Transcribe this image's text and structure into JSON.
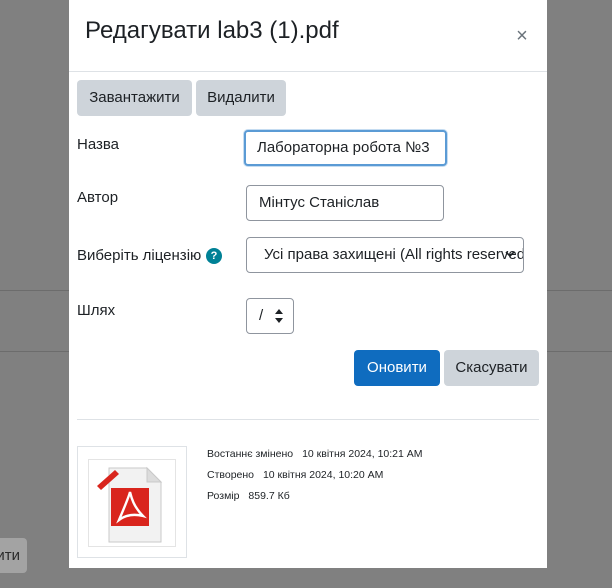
{
  "dialog": {
    "title": "Редагувати lab3 (1).pdf",
    "close_glyph": "×"
  },
  "toolbar": {
    "download_label": "Завантажити",
    "delete_label": "Видалити"
  },
  "form": {
    "name_label": "Назва",
    "name_value": "Лабораторна робота №3",
    "author_label": "Автор",
    "author_value": "Мінтус Станіслав",
    "license_label": "Виберіть ліцензію",
    "license_value": "Усі права захищені (All rights reserved)",
    "path_label": "Шлях",
    "path_value": "/"
  },
  "actions": {
    "update_label": "Оновити",
    "cancel_label": "Скасувати"
  },
  "file_info": {
    "modified_label": "Востаннє змінено",
    "modified_value": "10 квітня 2024, 10:21 AM",
    "created_label": "Створено",
    "created_value": "10 квітня 2024, 10:20 AM",
    "size_label": "Розмір",
    "size_value": "859.7 Кб"
  },
  "background": {
    "button_fragment": "ити"
  },
  "colors": {
    "primary": "#0f6cbf",
    "secondary": "#ced4da",
    "help_icon": "#008196",
    "pdf_red": "#d9251d"
  }
}
